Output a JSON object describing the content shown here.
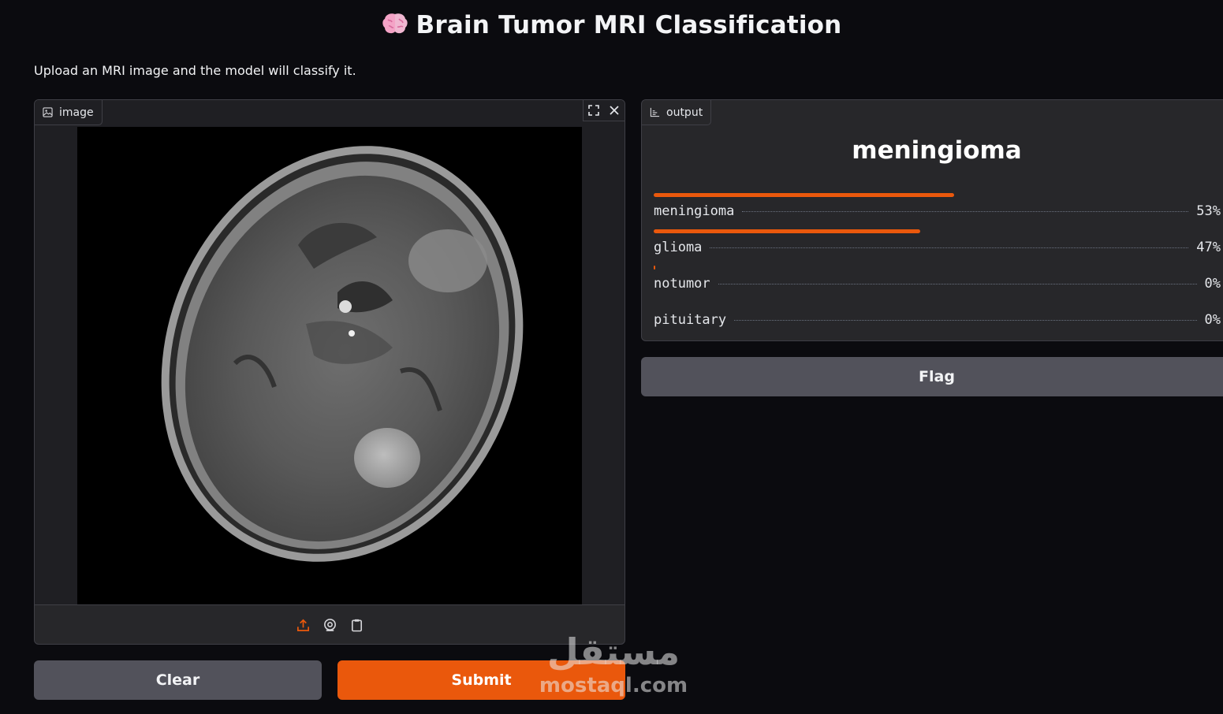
{
  "header": {
    "title": "Brain Tumor MRI Classification",
    "title_icon": "brain-emoji"
  },
  "description": "Upload an MRI image and the model will classify it.",
  "image_input": {
    "label": "image",
    "label_icon": "image-icon",
    "actions": [
      "fullscreen-icon",
      "close-icon"
    ],
    "sources": [
      "upload-icon",
      "webcam-icon",
      "clipboard-icon"
    ]
  },
  "buttons": {
    "clear": "Clear",
    "submit": "Submit",
    "flag": "Flag"
  },
  "output": {
    "label": "output",
    "label_icon": "bar-chart-icon",
    "prediction": "meningioma",
    "confidences": [
      {
        "label": "meningioma",
        "percent": "53%",
        "value": 0.53
      },
      {
        "label": "glioma",
        "percent": "47%",
        "value": 0.47
      },
      {
        "label": "notumor",
        "percent": "0%",
        "value": 0.002
      },
      {
        "label": "pituitary",
        "percent": "0%",
        "value": 0.0
      }
    ]
  },
  "watermark": {
    "arabic": "مستقل",
    "latin": "mostaql.com"
  },
  "colors": {
    "accent": "#ea580c",
    "background": "#0b0b0f",
    "panel": "#27272a",
    "button_secondary": "#52525b"
  }
}
